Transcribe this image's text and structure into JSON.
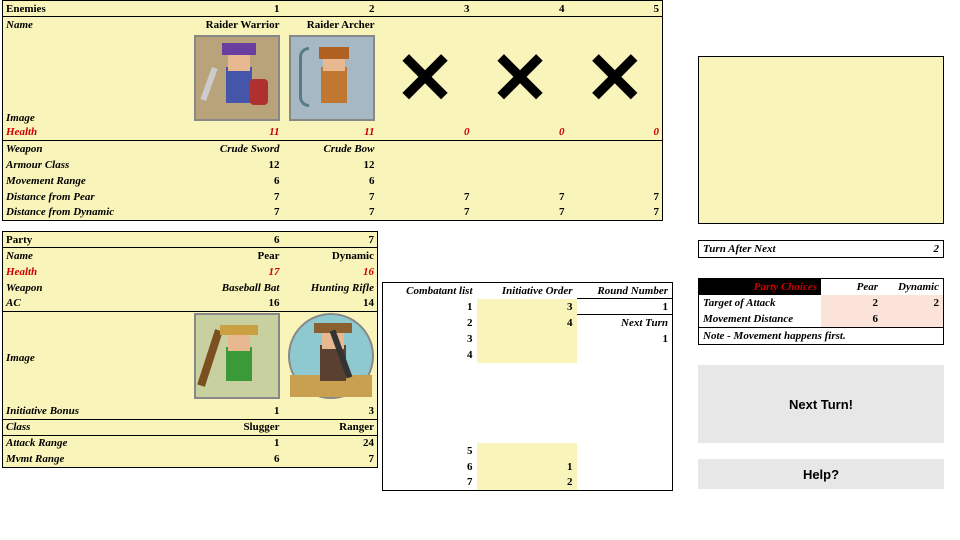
{
  "enemies": {
    "title": "Enemies",
    "cols": [
      "1",
      "2",
      "3",
      "4",
      "5"
    ],
    "name_label": "Name",
    "names": [
      "Raider Warrior",
      "Raider Archer",
      "",
      "",
      ""
    ],
    "image_label": "Image",
    "health_label": "Health",
    "health": [
      "11",
      "11",
      "0",
      "0",
      "0"
    ],
    "weapon_label": "Weapon",
    "weapons": [
      "Crude Sword",
      "Crude Bow",
      "",
      "",
      ""
    ],
    "ac_label": "Armour Class",
    "ac": [
      "12",
      "12",
      "",
      "",
      ""
    ],
    "move_label": "Movement Range",
    "move": [
      "6",
      "6",
      "",
      "",
      ""
    ],
    "dpear_label": "Distance from Pear",
    "dpear": [
      "7",
      "7",
      "7",
      "7",
      "7"
    ],
    "ddyn_label": "Distance from Dynamic",
    "ddyn": [
      "7",
      "7",
      "7",
      "7",
      "7"
    ]
  },
  "party": {
    "title": "Party",
    "cols": [
      "6",
      "7"
    ],
    "name_label": "Name",
    "names": [
      "Pear",
      "Dynamic"
    ],
    "health_label": "Health",
    "health": [
      "17",
      "16"
    ],
    "weapon_label": "Weapon",
    "weapons": [
      "Baseball Bat",
      "Hunting Rifle"
    ],
    "ac_label": "AC",
    "ac": [
      "16",
      "14"
    ],
    "image_label": "Image",
    "ib_label": "Initiative Bonus",
    "ib": [
      "1",
      "3"
    ],
    "class_label": "Class",
    "class": [
      "Slugger",
      "Ranger"
    ],
    "ar_label": "Attack Range",
    "ar": [
      "1",
      "24"
    ],
    "mr_label": "Mvmt Range",
    "mr": [
      "6",
      "7"
    ]
  },
  "init": {
    "col1": "Combatant list",
    "col2": "Initiative Order",
    "col3": "Round Number",
    "rows": [
      {
        "c": "1",
        "o": "3",
        "r": "1"
      },
      {
        "c": "2",
        "o": "4",
        "r": "Next Turn"
      },
      {
        "c": "3",
        "o": "",
        "r": "1"
      },
      {
        "c": "4",
        "o": "",
        "r": ""
      },
      {
        "c": "",
        "o": "",
        "r": ""
      },
      {
        "c": "",
        "o": "",
        "r": ""
      },
      {
        "c": "",
        "o": "",
        "r": ""
      },
      {
        "c": "",
        "o": "",
        "r": ""
      },
      {
        "c": "",
        "o": "",
        "r": ""
      },
      {
        "c": "5",
        "o": "",
        "r": ""
      },
      {
        "c": "6",
        "o": "1",
        "r": ""
      },
      {
        "c": "7",
        "o": "2",
        "r": ""
      }
    ]
  },
  "turn_after": {
    "label": "Turn After Next",
    "value": "2"
  },
  "choices": {
    "title": "Party Choices",
    "col1": "Pear",
    "col2": "Dynamic",
    "target_label": "Target of Attack",
    "target": [
      "2",
      "2"
    ],
    "move_label": "Movement Distance",
    "move": [
      "6",
      ""
    ],
    "note": "Note - Movement happens first."
  },
  "buttons": {
    "next": "Next Turn!",
    "help": "Help?"
  }
}
